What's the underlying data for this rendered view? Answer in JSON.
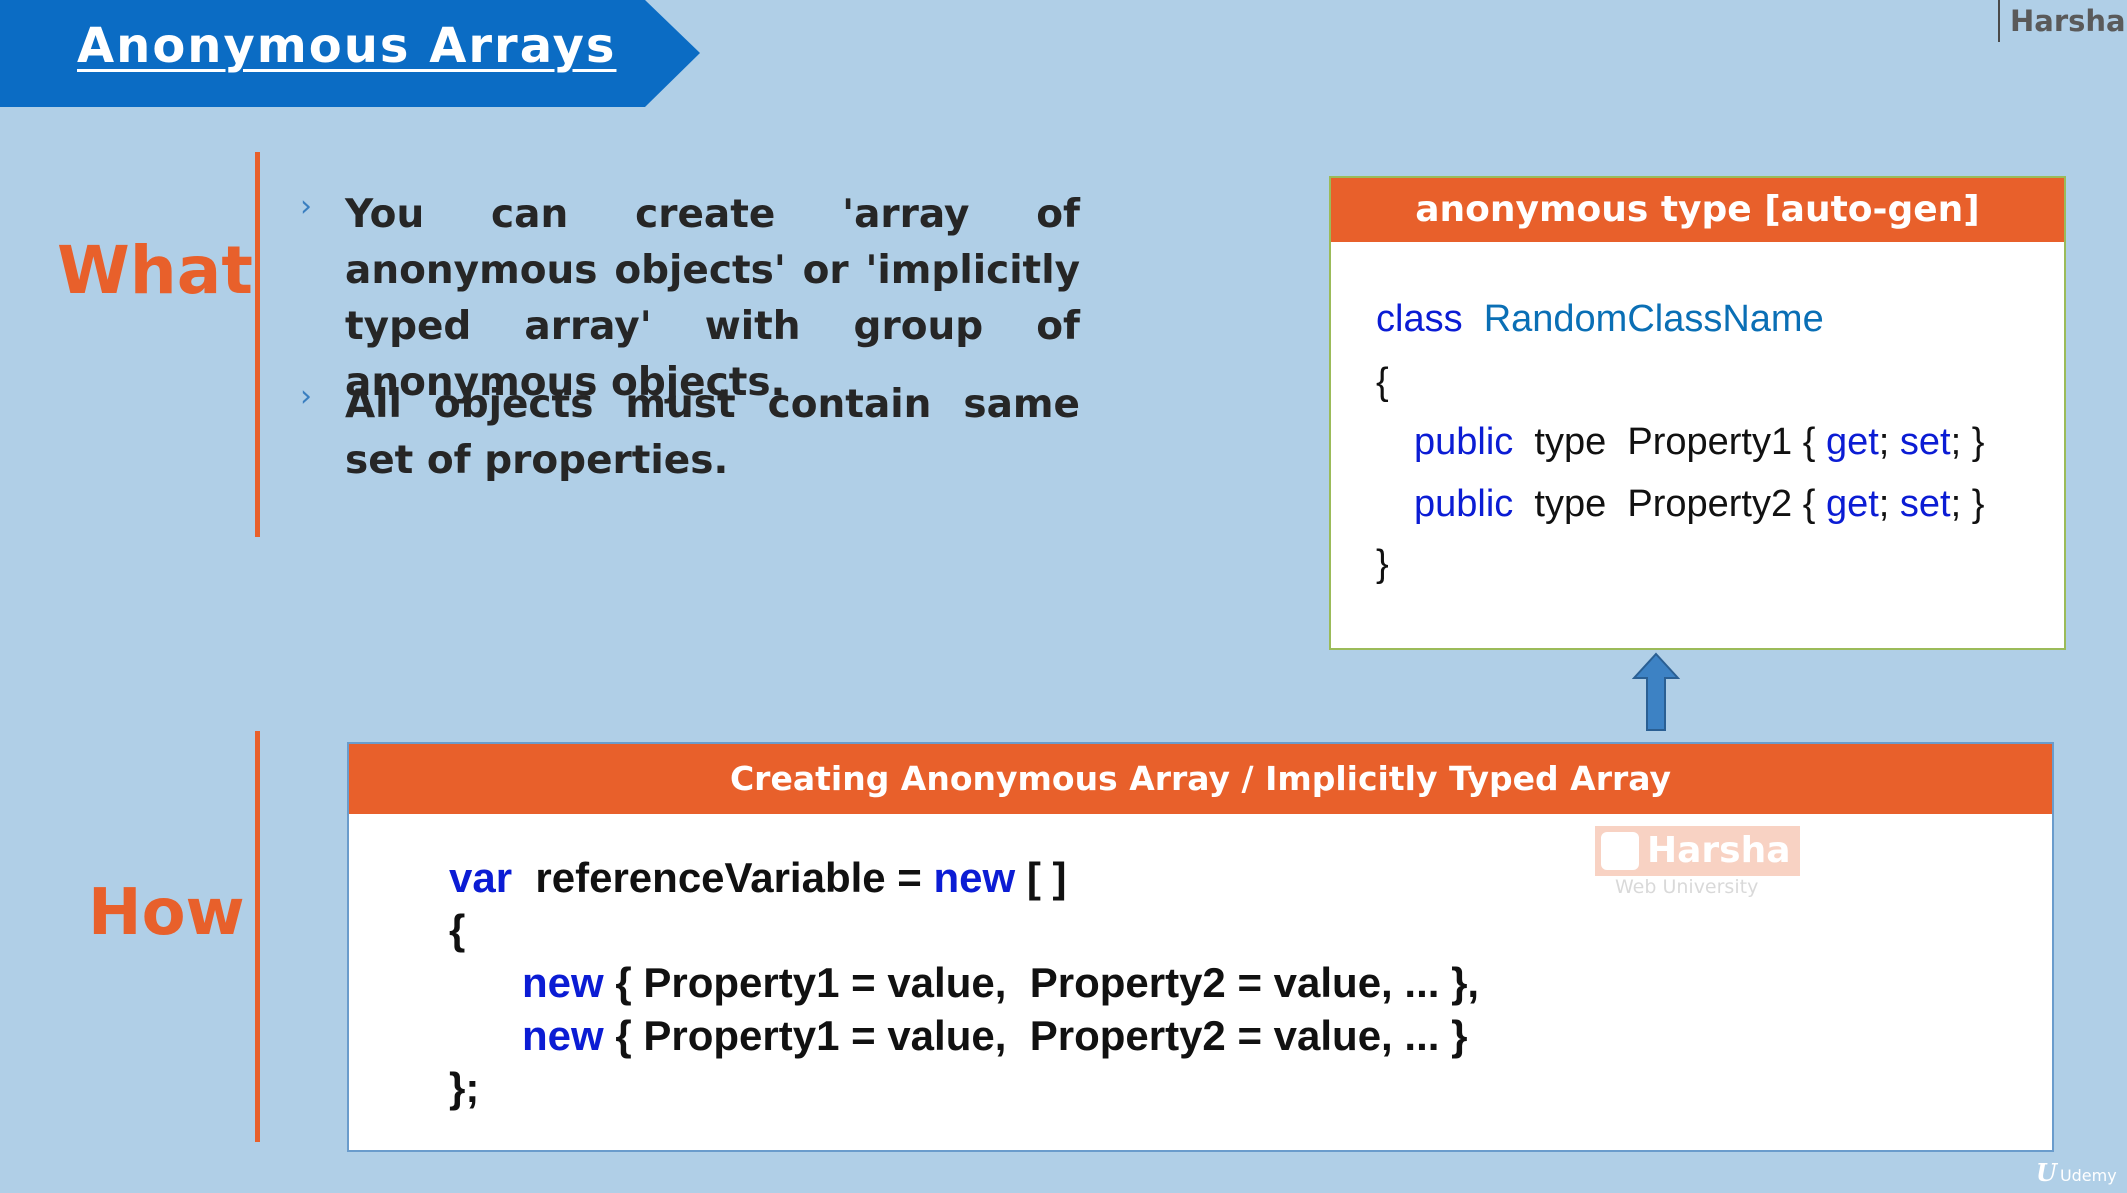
{
  "title": "Anonymous Arrays",
  "brand": "Harsha",
  "what": {
    "label": "What",
    "bullets": [
      "You can create 'array of anonymous objects' or 'implicitly typed array' with group of anonymous objects.",
      "All objects must contain same set of properties."
    ]
  },
  "anon_type": {
    "header": "anonymous type [auto-gen]",
    "kw_class": "class",
    "class_name": "RandomClassName",
    "open_brace": "{",
    "close_brace": "}",
    "kw_public": "public",
    "type_word": "type",
    "prop1": "Property1",
    "prop2": "Property2",
    "accessor_open": "{",
    "kw_get": "get",
    "kw_set": "set",
    "accessor_close": "}",
    "semicolon": ";"
  },
  "how": {
    "label": "How",
    "header": "Creating Anonymous Array / Implicitly Typed Array",
    "kw_var": "var",
    "decl_rest": "referenceVariable =",
    "kw_new": "new",
    "brackets": "[ ]",
    "open_brace": "{",
    "item1_rest": "{ Property1 = value,  Property2 = value, ... },",
    "item2_rest": "{ Property1 = value,  Property2 = value, ... }",
    "close": "};"
  },
  "watermark": {
    "name": "Harsha",
    "sub": "Web University"
  },
  "udemy": "Udemy",
  "colors": {
    "background": "#b0cfe7",
    "title_banner": "#0b6cc4",
    "accent_orange": "#e8602b",
    "keyword_blue": "#0b1cd4",
    "classname_teal": "#0a6fb5"
  },
  "icons": {
    "bullet": "chevron-right-icon",
    "arrow": "up-arrow-icon"
  }
}
